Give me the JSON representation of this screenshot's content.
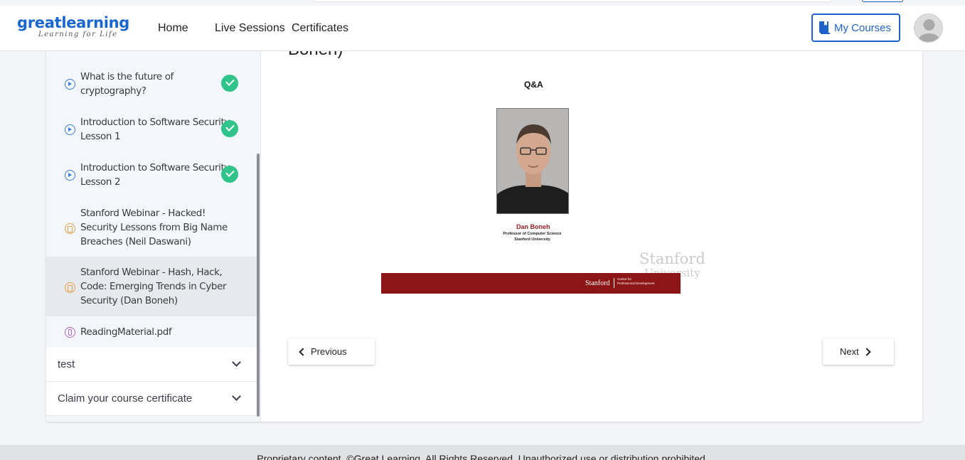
{
  "header": {
    "logo_main_part1": "great",
    "logo_main_part2": "learning",
    "logo_tagline": "Learning for Life",
    "nav": [
      "Home",
      "Live Sessions",
      "Certificates"
    ],
    "my_courses_label": "My Courses"
  },
  "sidebar": {
    "lessons": [
      {
        "label": "What is the future of cryptography?",
        "type": "video",
        "completed": true
      },
      {
        "label": "Introduction to Software Security Lesson 1",
        "type": "video",
        "completed": true
      },
      {
        "label": "Introduction to Software Security Lesson 2",
        "type": "video",
        "completed": true
      },
      {
        "label": "Stanford Webinar - Hacked! Security Lessons from Big Name Breaches (Neil Daswani)",
        "type": "document",
        "completed": false
      },
      {
        "label": "Stanford Webinar - Hash, Hack, Code: Emerging Trends in Cyber Security (Dan Boneh)",
        "type": "document",
        "completed": false,
        "active": true
      },
      {
        "label": "ReadingMaterial.pdf",
        "type": "pdf",
        "completed": false
      }
    ],
    "sections": [
      {
        "title": "test"
      },
      {
        "title": "Claim your course certificate"
      }
    ]
  },
  "content": {
    "title_fragment": "Boneh)",
    "slide": {
      "heading": "Q&A",
      "speaker_name": "Dan Boneh",
      "speaker_role": "Professor of Computer Science",
      "speaker_org": "Stanford University",
      "watermark_line1": "Stanford",
      "watermark_line2": "University",
      "footer_brand": "Stanford",
      "footer_center_line1": "Center for",
      "footer_center_line2": "Professional Development"
    },
    "prev_label": "Previous",
    "next_label": "Next"
  },
  "footer": {
    "text": "Proprietary content. ©Great Learning. All Rights Reserved. Unauthorized use or distribution prohibited."
  },
  "colors": {
    "brand_blue": "#1f62c7",
    "complete_green": "#2ec48a",
    "stanford_red": "#8c1515"
  }
}
